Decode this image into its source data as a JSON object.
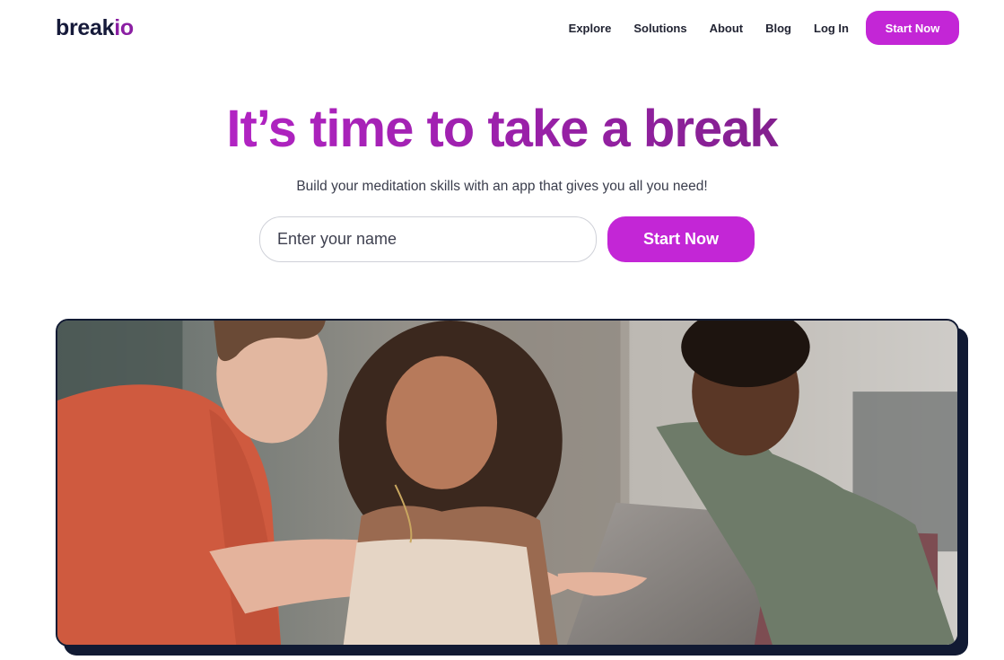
{
  "brand": {
    "logo_main": "break",
    "logo_accent": "io"
  },
  "nav": {
    "links": [
      "Explore",
      "Solutions",
      "About",
      "Blog",
      "Log In"
    ],
    "cta_label": "Start Now"
  },
  "hero": {
    "title": "It’s time to take a break",
    "subtitle": "Build your meditation skills with an app that gives you all you need!",
    "name_placeholder": "Enter your name",
    "cta_label": "Start Now"
  },
  "colors": {
    "accent": "#c326d6",
    "title_gradient_start": "#c326d6",
    "title_gradient_end": "#6e1e77",
    "card_shadow": "#111a33"
  }
}
